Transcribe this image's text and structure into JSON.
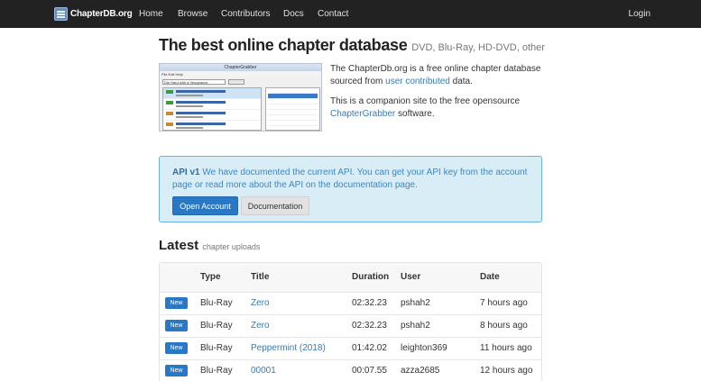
{
  "nav": {
    "brand": "ChapterDB.org",
    "items": [
      "Home",
      "Browse",
      "Contributors",
      "Docs",
      "Contact"
    ],
    "login": "Login"
  },
  "hero": {
    "title": "The best online chapter database",
    "subtitle": "DVD, Blu-Ray, HD-DVD, other",
    "screenshot": {
      "window_title": "ChapterGrabber",
      "menu": "File  Edit  Help",
      "search_value": "Die Hard with a Vengeance"
    },
    "intro_1_pre": "The ChapterDb.org is a free online chapter database sourced from ",
    "intro_1_link": "user contributed",
    "intro_1_post": " data.",
    "intro_2_pre": "This is a companion site to the free opensource ",
    "intro_2_link": "ChapterGrabber",
    "intro_2_post": " software."
  },
  "api": {
    "strong": "API v1",
    "text": " We have documented the current API. You can get your API key from the account page or read more about the API on the documentation page.",
    "open_account": "Open Account",
    "documentation": "Documentation"
  },
  "latest": {
    "title": "Latest",
    "subtitle": "chapter uploads",
    "columns": [
      "",
      "Type",
      "Title",
      "Duration",
      "User",
      "Date"
    ],
    "rows": [
      {
        "badge": "New",
        "type": "Blu-Ray",
        "title": "Zero",
        "duration": "02:32.23",
        "user": "pshah2",
        "date": "7 hours ago"
      },
      {
        "badge": "New",
        "type": "Blu-Ray",
        "title": "Zero",
        "duration": "02:32.23",
        "user": "pshah2",
        "date": "8 hours ago"
      },
      {
        "badge": "New",
        "type": "Blu-Ray",
        "title": "Peppermint (2018)",
        "duration": "01:42.02",
        "user": "leighton369",
        "date": "11 hours ago"
      },
      {
        "badge": "New",
        "type": "Blu-Ray",
        "title": "00001",
        "duration": "00:07.55",
        "user": "azza2685",
        "date": "12 hours ago"
      }
    ]
  }
}
